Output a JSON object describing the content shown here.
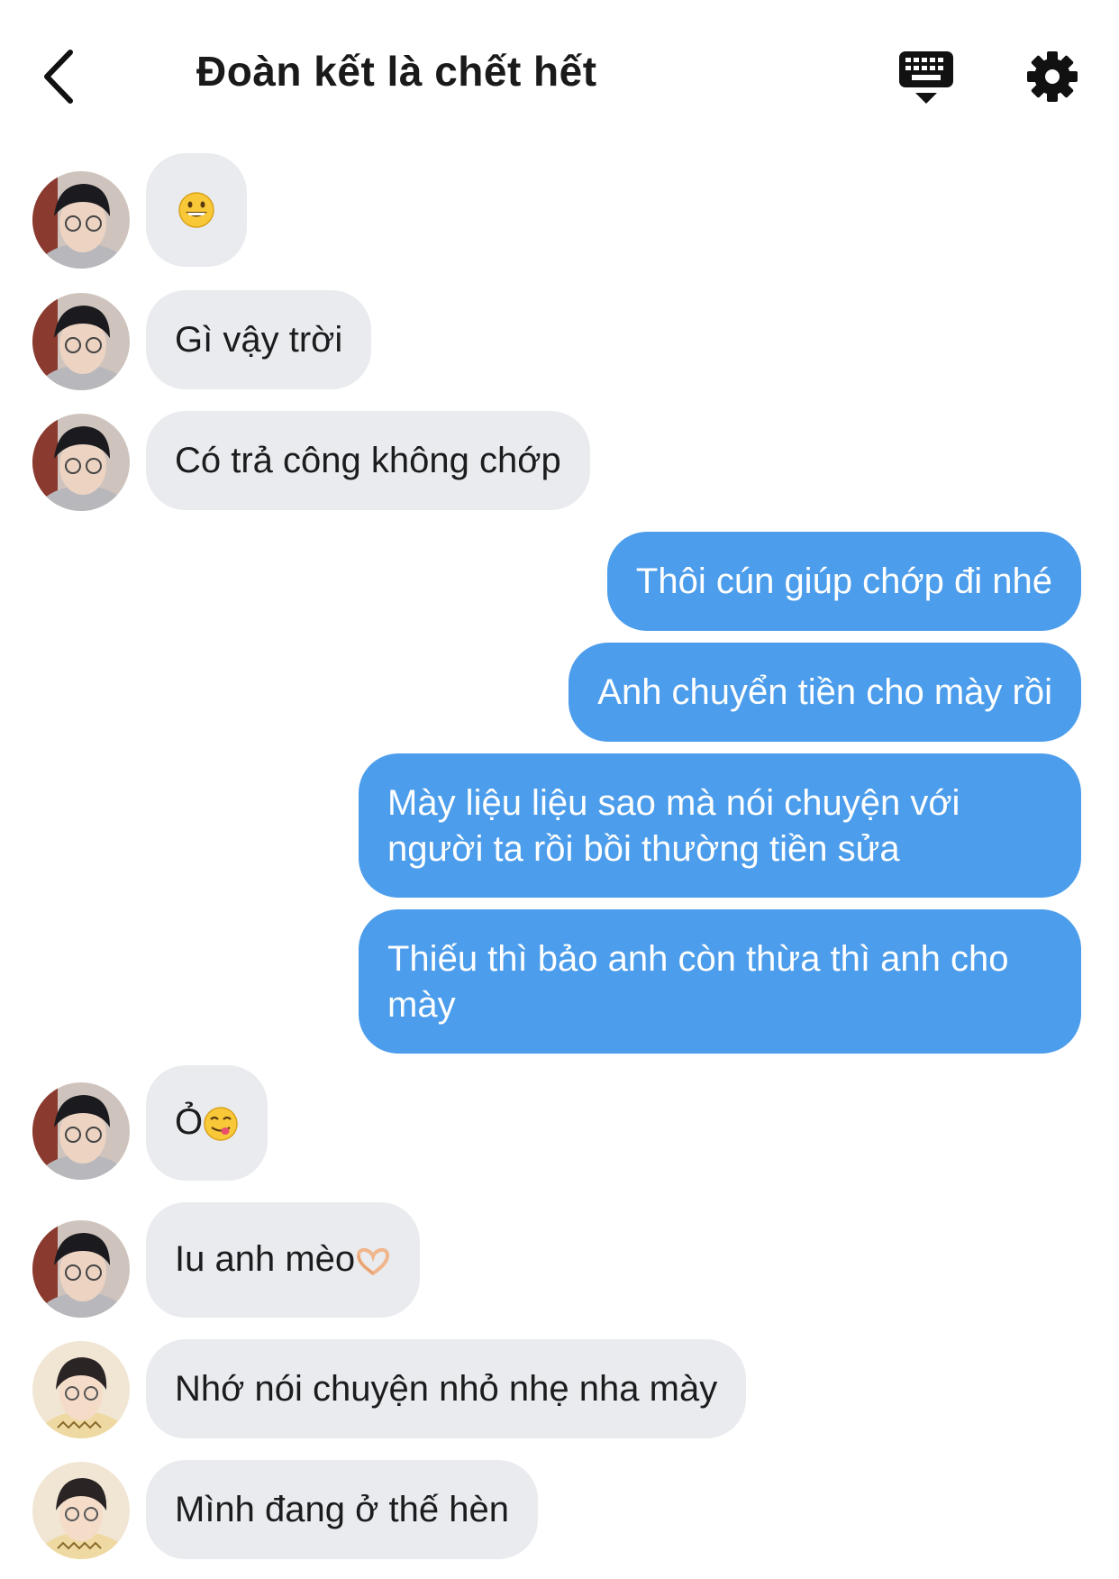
{
  "header": {
    "title": "Đoàn kết là chết hết"
  },
  "messages": [
    {
      "side": "in",
      "text": "",
      "emoji": "grinning-face"
    },
    {
      "side": "in",
      "text": "Gì vậy trời"
    },
    {
      "side": "in",
      "text": "Có trả công không chớp"
    },
    {
      "side": "out",
      "text": "Thôi cún giúp chớp đi nhé"
    },
    {
      "side": "out",
      "text": "Anh chuyển tiền cho mày rồi"
    },
    {
      "side": "out",
      "text": "Mày liệu liệu sao mà nói chuyện với người ta rồi bồi thường tiền sửa"
    },
    {
      "side": "out",
      "text": "Thiếu thì bảo anh còn thừa thì anh cho mày"
    },
    {
      "side": "in",
      "text": "Ỏ",
      "emoji": "face-savoring-food"
    },
    {
      "side": "in",
      "text": "Iu anh mèo",
      "emoji": "heart-hands"
    },
    {
      "side": "in",
      "text": "Nhớ nói chuyện nhỏ nhẹ nha mày"
    },
    {
      "side": "in",
      "text": "Mình đang ở thế hèn"
    }
  ],
  "colors": {
    "incoming_bubble": "#e9ebee",
    "outgoing_bubble": "#4c9deb",
    "outgoing_text": "#ffffff"
  },
  "icons": {
    "back": "chevron-left-icon",
    "keyboard": "keyboard-hide-icon",
    "settings": "gear-icon"
  }
}
